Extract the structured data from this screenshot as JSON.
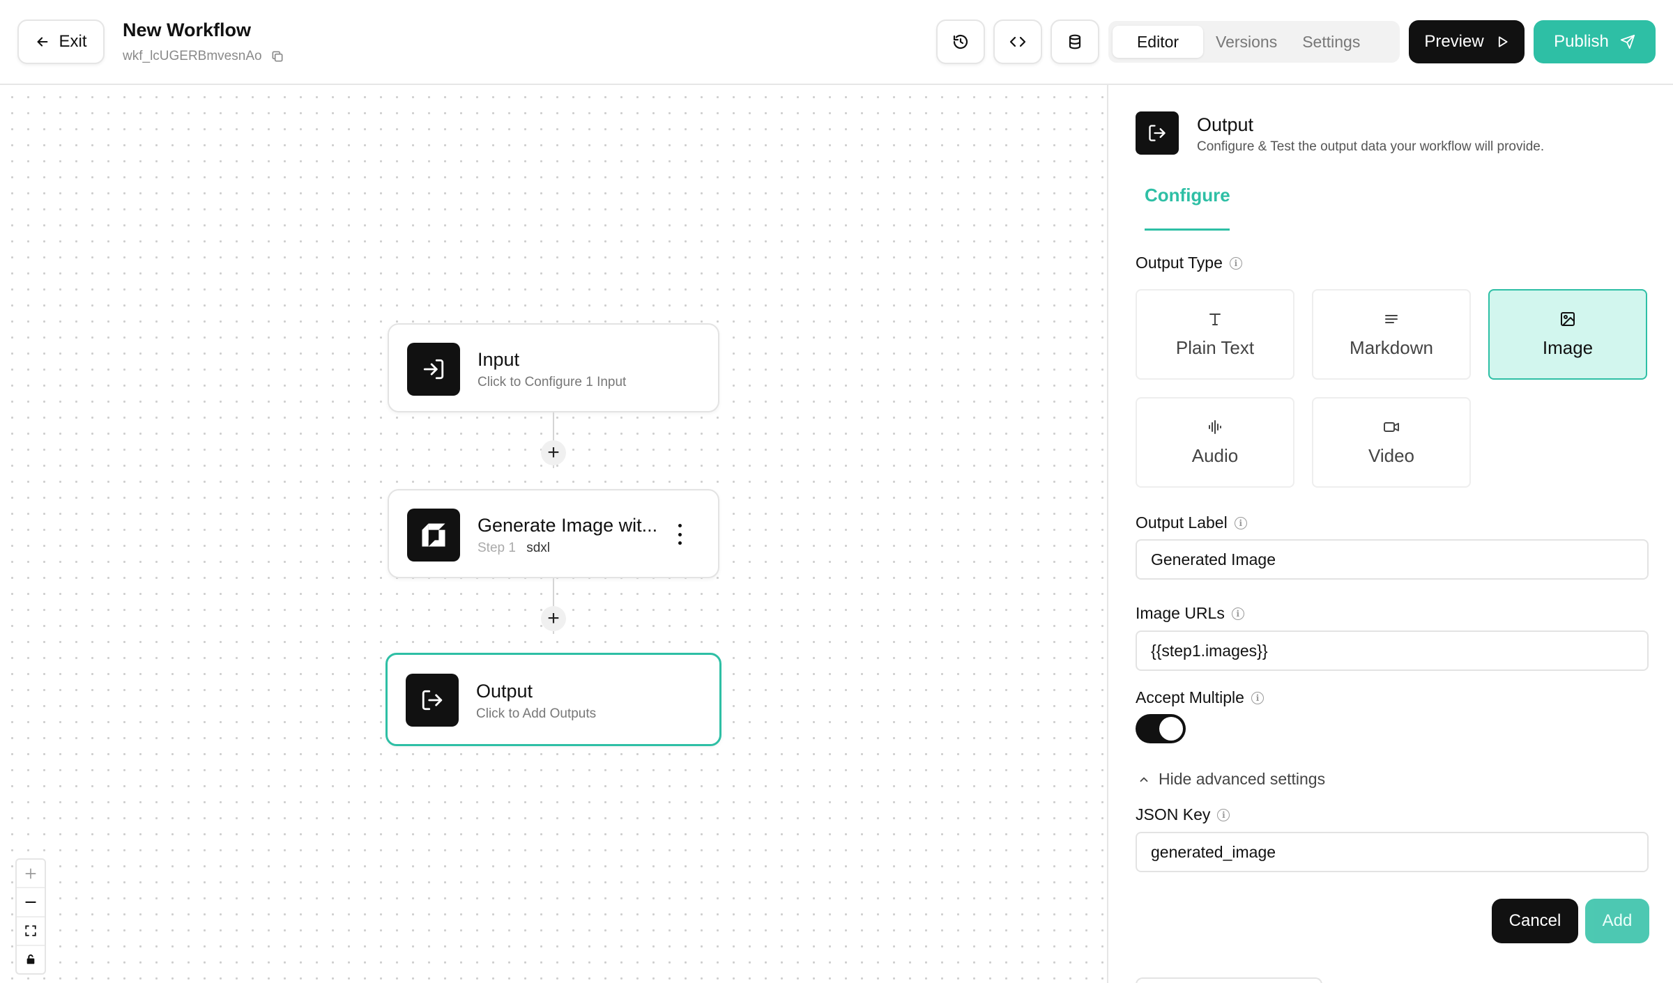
{
  "header": {
    "exit_label": "Exit",
    "workflow_title": "New Workflow",
    "workflow_id": "wkf_lcUGERBmvesnAo",
    "tabs": [
      {
        "label": "Editor",
        "active": true
      },
      {
        "label": "Versions",
        "active": false
      },
      {
        "label": "Settings",
        "active": false
      }
    ],
    "preview_label": "Preview",
    "publish_label": "Publish"
  },
  "canvas": {
    "nodes": [
      {
        "title": "Input",
        "subtitle": "Click to Configure 1 Input",
        "icon": "sign-in-icon"
      },
      {
        "title": "Generate Image wit...",
        "step": "Step 1",
        "model": "sdxl",
        "icon": "model-logo-icon"
      },
      {
        "title": "Output",
        "subtitle": "Click to Add Outputs",
        "icon": "sign-out-icon",
        "selected": true
      }
    ],
    "add_symbol": "+"
  },
  "panel": {
    "title": "Output",
    "subtitle": "Configure & Test the output data your workflow will provide.",
    "tab": "Configure",
    "output_type_label": "Output Type",
    "output_types": [
      {
        "label": "Plain Text",
        "icon": "text-icon",
        "selected": false
      },
      {
        "label": "Markdown",
        "icon": "markdown-icon",
        "selected": false
      },
      {
        "label": "Image",
        "icon": "image-icon",
        "selected": true
      },
      {
        "label": "Audio",
        "icon": "audio-wave-icon",
        "selected": false
      },
      {
        "label": "Video",
        "icon": "video-camera-icon",
        "selected": false
      }
    ],
    "output_label_label": "Output Label",
    "output_label_value": "Generated Image",
    "image_urls_label": "Image URLs",
    "image_urls_value": "{{step1.images}}",
    "accept_multiple_label": "Accept Multiple",
    "accept_multiple_on": true,
    "advanced_toggle_label": "Hide advanced settings",
    "json_key_label": "JSON Key",
    "json_key_value": "generated_image",
    "cancel_label": "Cancel",
    "add_label": "Add"
  },
  "colors": {
    "accent": "#2ebfa5",
    "accent_light": "#d2f6ee",
    "dark": "#111111"
  }
}
